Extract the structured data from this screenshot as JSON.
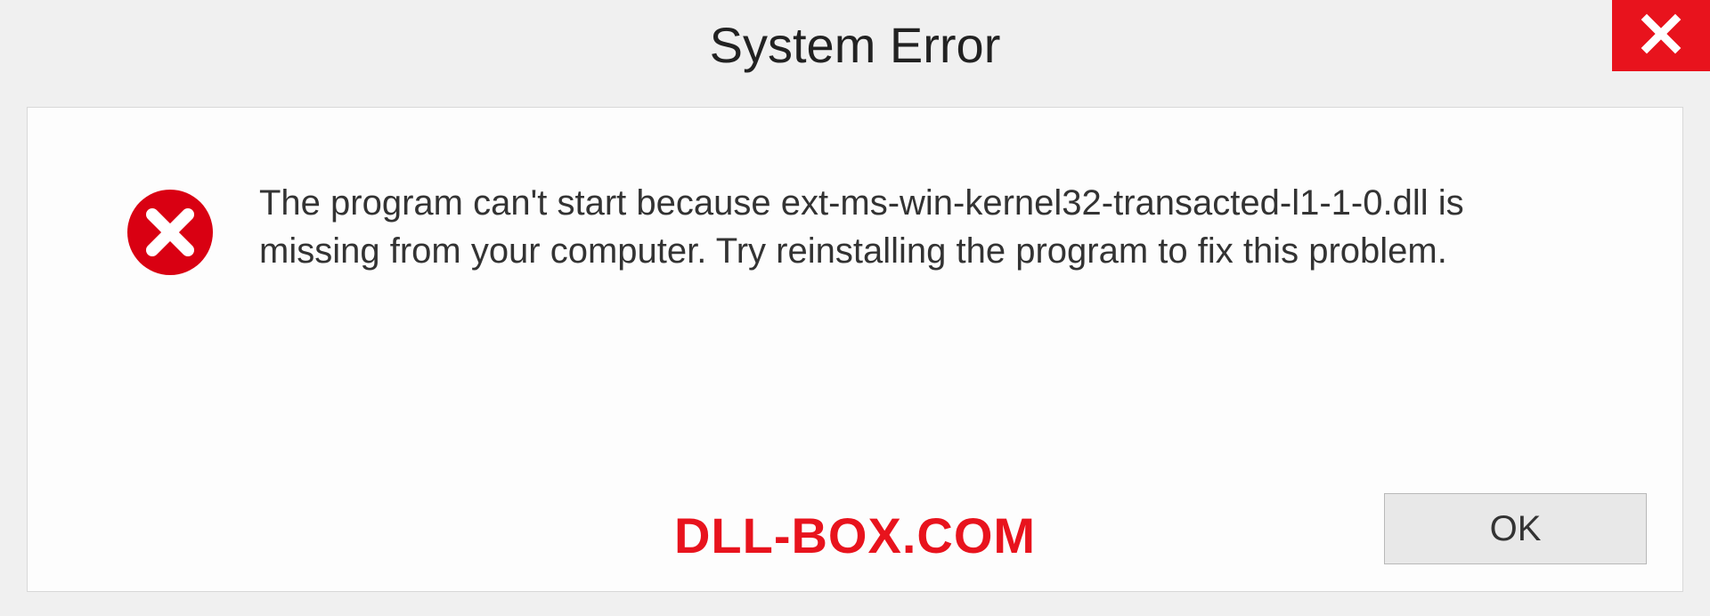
{
  "dialog": {
    "title": "System Error",
    "message": "The program can't start because ext-ms-win-kernel32-transacted-l1-1-0.dll is missing from your computer. Try reinstalling the program to fix this problem.",
    "ok_label": "OK"
  },
  "watermark": {
    "text": "DLL-BOX.COM"
  },
  "colors": {
    "accent_red": "#e8131d",
    "panel_bg": "#fdfdfd",
    "window_bg": "#f0f0f0"
  }
}
